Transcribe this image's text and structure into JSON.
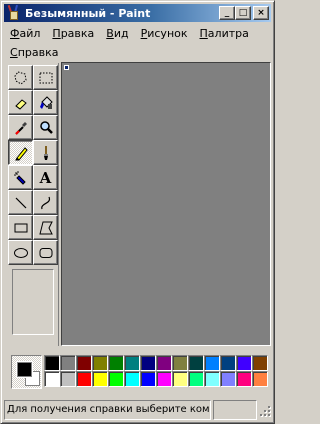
{
  "window": {
    "title": "Безымянный - Paint",
    "buttons": {
      "minimize": "_",
      "maximize": "□",
      "close": "×"
    }
  },
  "menu": {
    "row1": [
      {
        "label": "Файл",
        "accel": "Ф",
        "rest": "айл"
      },
      {
        "label": "Правка",
        "accel": "П",
        "rest": "равка"
      },
      {
        "label": "Вид",
        "accel": "В",
        "rest": "ид"
      },
      {
        "label": "Рисунок",
        "accel": "Р",
        "rest": "исунок"
      },
      {
        "label": "Палитра",
        "accel": "П",
        "rest": "алитра"
      }
    ],
    "row2": [
      {
        "label": "Справка",
        "accel": "С",
        "rest": "правка"
      }
    ]
  },
  "tools": [
    {
      "name": "free-form-select",
      "icon": "free-select-icon"
    },
    {
      "name": "select",
      "icon": "rect-select-icon"
    },
    {
      "name": "eraser",
      "icon": "eraser-icon"
    },
    {
      "name": "fill",
      "icon": "fill-bucket-icon"
    },
    {
      "name": "pick-color",
      "icon": "eyedropper-icon"
    },
    {
      "name": "magnifier",
      "icon": "magnifier-icon"
    },
    {
      "name": "pencil",
      "icon": "pencil-icon",
      "active": true
    },
    {
      "name": "brush",
      "icon": "brush-icon"
    },
    {
      "name": "airbrush",
      "icon": "airbrush-icon"
    },
    {
      "name": "text",
      "icon": "text-icon",
      "glyph": "A"
    },
    {
      "name": "line",
      "icon": "line-icon"
    },
    {
      "name": "curve",
      "icon": "curve-icon"
    },
    {
      "name": "rectangle",
      "icon": "rectangle-icon"
    },
    {
      "name": "polygon",
      "icon": "polygon-icon"
    },
    {
      "name": "ellipse",
      "icon": "ellipse-icon"
    },
    {
      "name": "rounded-rectangle",
      "icon": "rounded-rect-icon"
    }
  ],
  "colors": {
    "foreground": "#000000",
    "background": "#ffffff",
    "palette_row1": [
      "#000000",
      "#808080",
      "#800000",
      "#808000",
      "#008000",
      "#008080",
      "#000080",
      "#800080",
      "#808040",
      "#004040",
      "#0080ff",
      "#004080",
      "#4000ff",
      "#804000"
    ],
    "palette_row2": [
      "#ffffff",
      "#c0c0c0",
      "#ff0000",
      "#ffff00",
      "#00ff00",
      "#00ffff",
      "#0000ff",
      "#ff00ff",
      "#ffff80",
      "#00ff80",
      "#80ffff",
      "#8080ff",
      "#ff0080",
      "#ff8040"
    ]
  },
  "status": {
    "help_text": "Для получения справки выберите команду",
    "position": ""
  }
}
